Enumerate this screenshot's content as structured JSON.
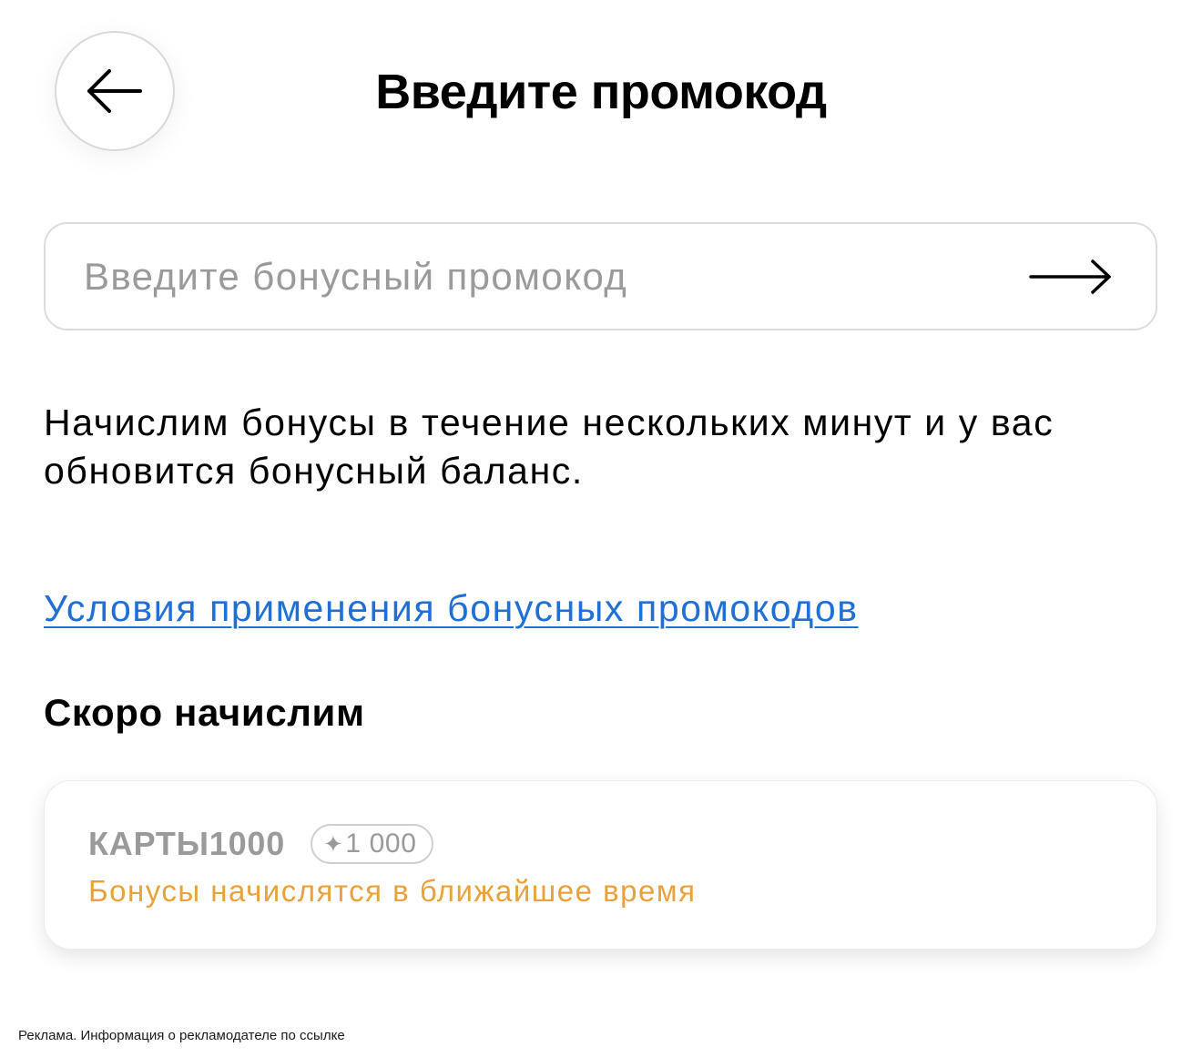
{
  "header": {
    "title": "Введите промокод",
    "back_icon": "arrow-left-icon"
  },
  "promo_form": {
    "value": "",
    "placeholder": "Введите бонусный промокод",
    "submit_icon": "arrow-right-icon"
  },
  "info": {
    "text": "Начислим бонусы в течение нескольких минут и у вас обновится бонусный баланс."
  },
  "terms_link": {
    "label": "Условия применения бонусных промокодов"
  },
  "pending": {
    "heading": "Скоро начислим",
    "items": [
      {
        "code": "КАРТЫ1000",
        "bonus_icon": "sparkle-icon",
        "bonus_symbol": "✦",
        "bonus_amount": "1 000",
        "status": "Бонусы начислятся в ближайшее время"
      }
    ]
  },
  "footer": {
    "ad_text": "Реклама. Информация о рекламодателе по ссылке"
  },
  "colors": {
    "link": "#1f6fd6",
    "status_pending": "#e9a23b",
    "muted": "#9a9a9a",
    "border": "#dcdcdc"
  }
}
